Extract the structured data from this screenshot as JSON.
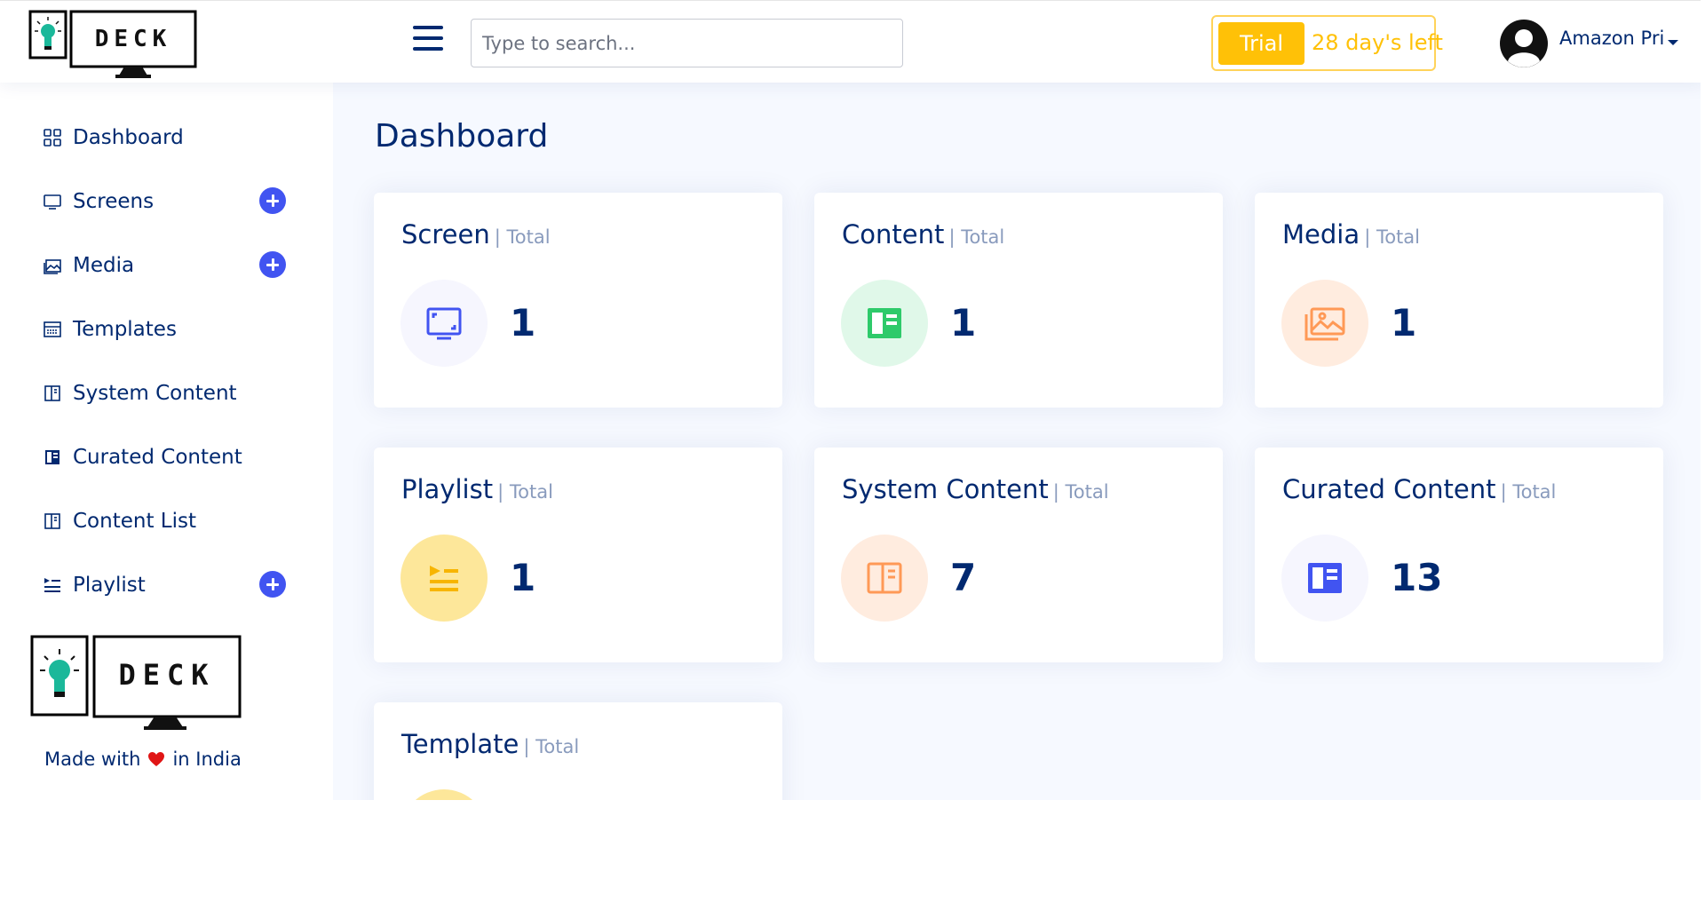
{
  "header": {
    "logo_text": "DECK",
    "search_placeholder": "Type to search...",
    "trial_label": "Trial",
    "trial_days_left": "28 day's left",
    "user_name": "Amazon Pri"
  },
  "sidebar": {
    "items": [
      {
        "label": "Dashboard",
        "icon": "grid-icon",
        "has_add": false
      },
      {
        "label": "Screens",
        "icon": "monitor-icon",
        "has_add": true
      },
      {
        "label": "Media",
        "icon": "images-icon",
        "has_add": true
      },
      {
        "label": "Templates",
        "icon": "template-icon",
        "has_add": false
      },
      {
        "label": "System Content",
        "icon": "layout-icon",
        "has_add": false
      },
      {
        "label": "Curated Content",
        "icon": "layout-filled-icon",
        "has_add": false
      },
      {
        "label": "Content List",
        "icon": "layout-icon",
        "has_add": false
      },
      {
        "label": "Playlist",
        "icon": "playlist-icon",
        "has_add": true
      }
    ],
    "footer_logo_text": "DECK",
    "made_with_prefix": "Made with",
    "made_with_suffix": "in India"
  },
  "main": {
    "title": "Dashboard",
    "cards": [
      {
        "title": "Screen",
        "subtitle": "| Total",
        "value": "1",
        "icon": "screen-icon",
        "icon_color": "#4154f1",
        "bg_color": "#f6f6fe"
      },
      {
        "title": "Content",
        "subtitle": "| Total",
        "value": "1",
        "icon": "content-icon",
        "icon_color": "#2eca6a",
        "bg_color": "#e0f8e9"
      },
      {
        "title": "Media",
        "subtitle": "| Total",
        "value": "1",
        "icon": "media-icon",
        "icon_color": "#ff771d",
        "bg_color": "#ffecdf"
      },
      {
        "title": "Playlist",
        "subtitle": "| Total",
        "value": "1",
        "icon": "playlist-icon",
        "icon_color": "#f7b500",
        "bg_color": "#fde79a"
      },
      {
        "title": "System Content",
        "subtitle": "| Total",
        "value": "7",
        "icon": "system-content-icon",
        "icon_color": "#ff771d",
        "bg_color": "#ffecdf"
      },
      {
        "title": "Curated Content",
        "subtitle": "| Total",
        "value": "13",
        "icon": "curated-content-icon",
        "icon_color": "#4154f1",
        "bg_color": "#f6f6fe"
      },
      {
        "title": "Template",
        "subtitle": "| Total",
        "value": "",
        "icon": "template-icon",
        "icon_color": "#f7b500",
        "bg_color": "#fde79a"
      }
    ]
  },
  "colors": {
    "primary_navy": "#012970",
    "accent_blue": "#4154f1",
    "trial_yellow": "#ffc107",
    "page_bg": "#f6f9ff"
  }
}
